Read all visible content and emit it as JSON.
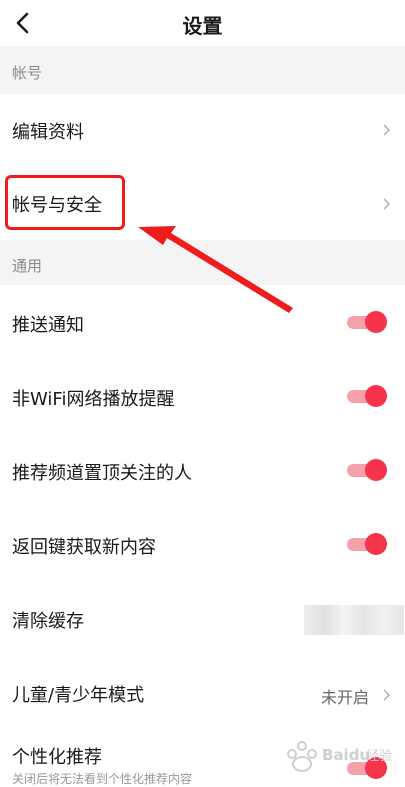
{
  "header": {
    "title": "设置"
  },
  "sections": {
    "account": "帐号",
    "general": "通用"
  },
  "rows": {
    "edit_profile": "编辑资料",
    "account_security": "帐号与安全",
    "push": "推送通知",
    "nonwifi": "非WiFi网络播放提醒",
    "pin_channel": "推荐频道置顶关注的人",
    "back_refresh": "返回键获取新内容",
    "clear_cache": "清除缓存",
    "kids_mode": "儿童/青少年模式",
    "kids_mode_value": "未开启",
    "personalized": "个性化推荐",
    "personalized_sub": "关闭后将无法看到个性化推荐内容"
  },
  "toggles": {
    "push": true,
    "nonwifi": true,
    "pin_channel": true,
    "back_refresh": true,
    "personalized": true
  },
  "colors": {
    "accent": "#f5334b",
    "highlight": "#ef1c1c"
  },
  "watermark": "Baidu 经验"
}
